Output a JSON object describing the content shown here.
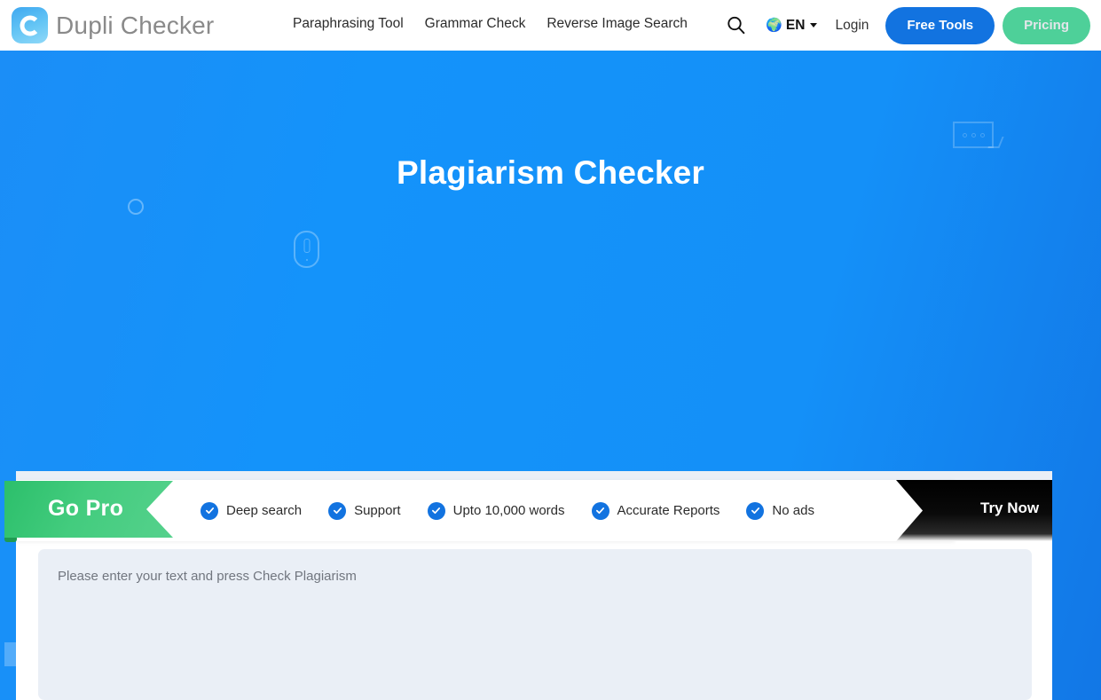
{
  "header": {
    "logo_text": "Dupli Checker",
    "nav": [
      {
        "label": "Paraphrasing Tool"
      },
      {
        "label": "Grammar Check"
      },
      {
        "label": "Reverse Image Search"
      }
    ],
    "search_icon": "search-icon",
    "language": {
      "icon": "globe-icon",
      "code": "EN"
    },
    "login_label": "Login",
    "free_tools_label": "Free Tools",
    "pricing_label": "Pricing",
    "colors": {
      "free_tools_bg": "#1273e0",
      "pricing_bg": "#4ed099",
      "logo_text": "#8a8a8a"
    }
  },
  "hero": {
    "title": "Plagiarism Checker",
    "background": "#1493fa",
    "decorations": [
      {
        "name": "circle-outline"
      },
      {
        "name": "mouse-icon"
      },
      {
        "name": "chat-bubble-icon"
      },
      {
        "name": "square-accent"
      }
    ]
  },
  "promo": {
    "ribbon_label": "Go Pro",
    "ribbon_color": "#43cc7e",
    "cta_label": "Try Now",
    "cta_bg": "#000000",
    "features": [
      {
        "label": "Deep search"
      },
      {
        "label": "Support"
      },
      {
        "label": "Upto 10,000 words"
      },
      {
        "label": "Accurate Reports"
      },
      {
        "label": "No ads"
      }
    ],
    "check_color": "#1273e0"
  },
  "editor": {
    "placeholder": "Please enter your text and press Check Plagiarism",
    "value": "",
    "background": "#eaeff6"
  }
}
